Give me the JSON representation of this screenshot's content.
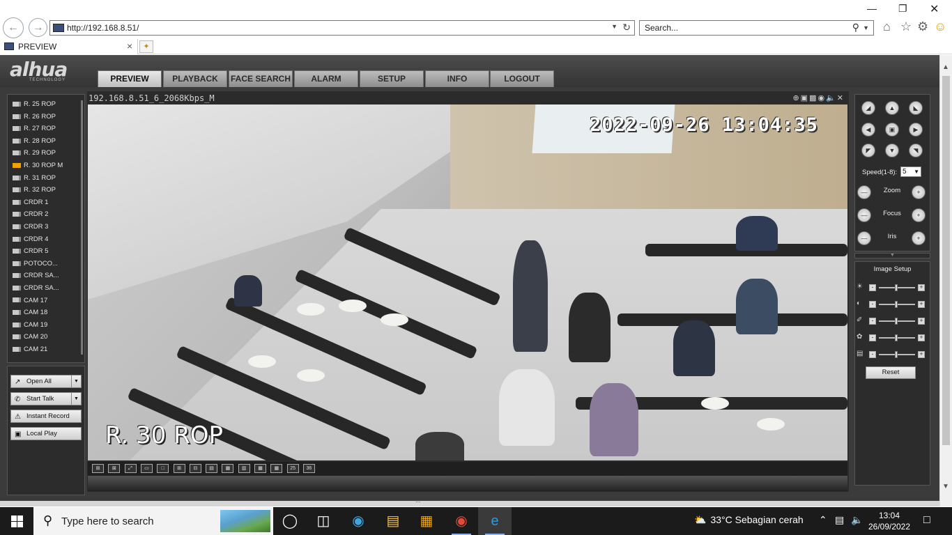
{
  "browser": {
    "url": "http://192.168.8.51/",
    "search_placeholder": "Search...",
    "tab_title": "PREVIEW"
  },
  "app": {
    "logo": "alhua",
    "logo_sub": "TECHNOLOGY",
    "tabs": [
      "PREVIEW",
      "PLAYBACK",
      "FACE SEARCH",
      "ALARM",
      "SETUP",
      "INFO",
      "LOGOUT"
    ],
    "active_tab": "PREVIEW"
  },
  "devices": [
    {
      "label": "R. 25 ROP"
    },
    {
      "label": "R. 26 ROP"
    },
    {
      "label": "R. 27 ROP"
    },
    {
      "label": "R. 28 ROP"
    },
    {
      "label": "R. 29 ROP"
    },
    {
      "label": "R. 30 ROP   M",
      "active": true
    },
    {
      "label": "R. 31 ROP"
    },
    {
      "label": "R. 32 ROP"
    },
    {
      "label": "CRDR 1"
    },
    {
      "label": "CRDR 2"
    },
    {
      "label": "CRDR 3"
    },
    {
      "label": "CRDR 4"
    },
    {
      "label": "CRDR 5"
    },
    {
      "label": "POTOCO..."
    },
    {
      "label": "CRDR SA..."
    },
    {
      "label": "CRDR SA..."
    },
    {
      "label": "CAM 17"
    },
    {
      "label": "CAM 18"
    },
    {
      "label": "CAM 19"
    },
    {
      "label": "CAM 20"
    },
    {
      "label": "CAM 21"
    }
  ],
  "actions": {
    "open_all": "Open All",
    "start_talk": "Start Talk",
    "instant_record": "Instant Record",
    "local_play": "Local Play"
  },
  "video": {
    "stream_label": "192.168.8.51_6_2068Kbps_M",
    "osd_time": "2022-09-26 13:04:35",
    "osd_name": "R. 30 ROP",
    "layout_buttons": [
      "⊞",
      "⊠",
      "⤢",
      "▭",
      "□",
      "⊞",
      "⊟",
      "▤",
      "▦",
      "▥",
      "▦",
      "▦",
      "25",
      "36"
    ]
  },
  "ptz": {
    "speed_label": "Speed(1-8):",
    "speed_value": "5",
    "zoom": "Zoom",
    "focus": "Focus",
    "iris": "Iris"
  },
  "image_setup": {
    "title": "Image Setup",
    "reset": "Reset"
  },
  "footer_text": "...",
  "taskbar": {
    "search_text": "Type here to search",
    "weather": "33°C  Sebagian cerah",
    "time": "13:04",
    "date": "26/09/2022"
  }
}
